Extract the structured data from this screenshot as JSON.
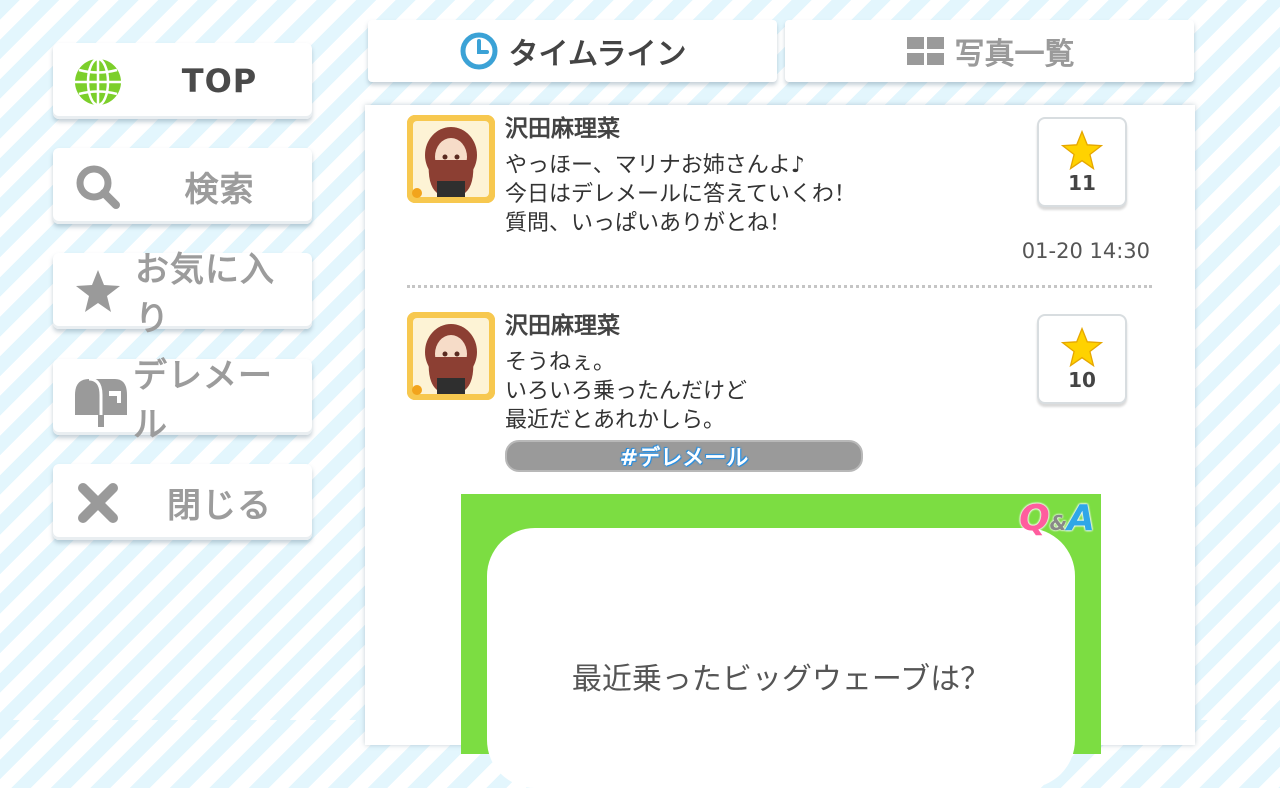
{
  "sidebar": {
    "top_label": "TOP",
    "search_label": "検索",
    "favorites_label": "お気に入り",
    "deremail_label": "デレメール",
    "close_label": "閉じる"
  },
  "tabs": {
    "timeline_label": "タイムライン",
    "photos_label": "写真一覧"
  },
  "posts": [
    {
      "author": "沢田麻理菜",
      "lines": [
        "やっほー、マリナお姉さんよ♪",
        "今日はデレメールに答えていくわ！",
        "質問、いっぱいありがとね！"
      ],
      "likes": "11",
      "timestamp": "01-20 14:30"
    },
    {
      "author": "沢田麻理菜",
      "lines": [
        "そうねぇ。",
        "いろいろ乗ったんだけど",
        "最近だとあれかしら。"
      ],
      "likes": "10",
      "tag": "#デレメール",
      "qa_logo_q": "Q",
      "qa_logo_amp": "&",
      "qa_logo_a": "A",
      "qa_question": "最近乗ったビッグウェーブは？"
    }
  ],
  "colors": {
    "accent_blue": "#3ba2d6",
    "qa_green": "#7cdd42",
    "star_yellow": "#ffd200",
    "tag_gray": "#9a9a9a"
  }
}
